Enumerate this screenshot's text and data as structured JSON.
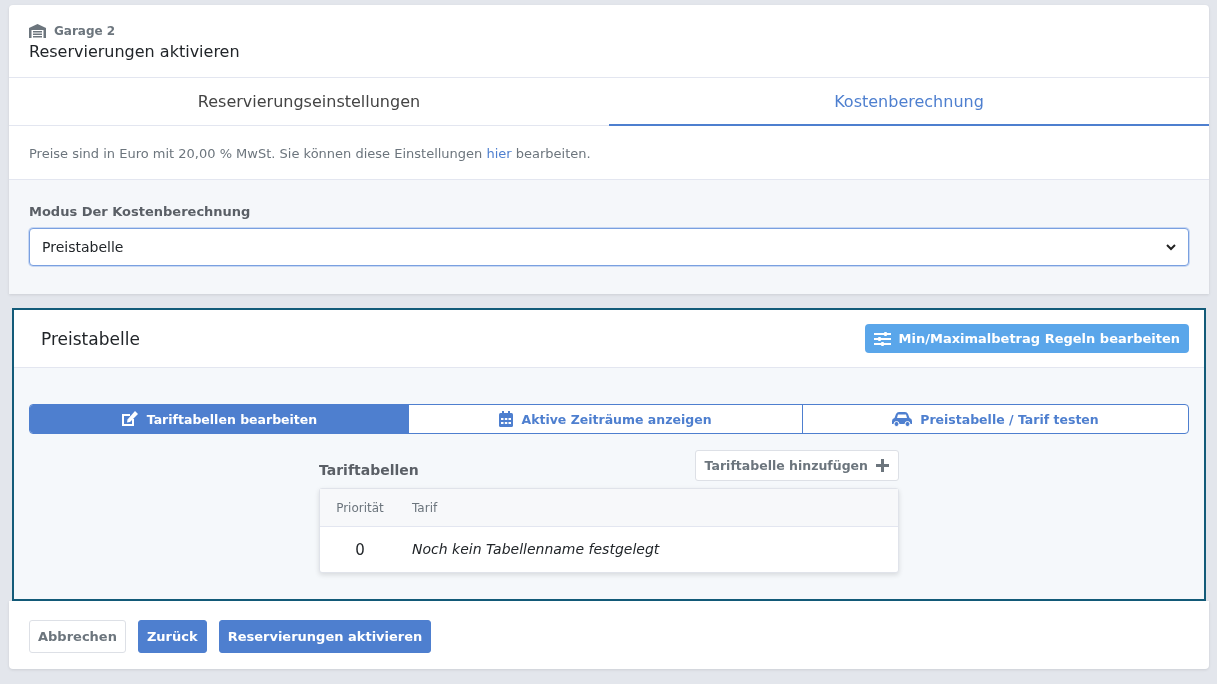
{
  "header": {
    "garage": "Garage 2",
    "title": "Reservierungen aktivieren"
  },
  "tabs": [
    {
      "label": "Reservierungseinstellungen",
      "selected": false
    },
    {
      "label": "Kostenberechnung",
      "selected": true
    }
  ],
  "info": {
    "before": "Preise sind in Euro mit 20,00 % MwSt. Sie können diese Einstellungen",
    "link": "hier",
    "after": "bearbeiten."
  },
  "mode": {
    "label": "Modus Der Kostenberechnung",
    "value": "Preistabelle"
  },
  "panel": {
    "title": "Preistabelle",
    "rules_button": "Min/Maximalbetrag Regeln bearbeiten",
    "subtabs": [
      {
        "label": "Tariftabellen bearbeiten",
        "kind": "edit",
        "selected": true
      },
      {
        "label": "Aktive Zeiträume anzeigen",
        "kind": "calendar",
        "selected": false
      },
      {
        "label": "Preistabelle / Tarif testen",
        "kind": "car",
        "selected": false
      }
    ],
    "tables_title": "Tariftabellen",
    "add_button": "Tariftabelle hinzufügen",
    "columns": [
      "Priorität",
      "Tarif"
    ],
    "rows": [
      {
        "priority": "0",
        "tarif": "Noch kein Tabellenname festgelegt"
      }
    ]
  },
  "footer": [
    {
      "label": "Abbrechen",
      "kind": "outline"
    },
    {
      "label": "Zurück",
      "kind": "primary"
    },
    {
      "label": "Reservierungen aktivieren",
      "kind": "primary"
    }
  ]
}
